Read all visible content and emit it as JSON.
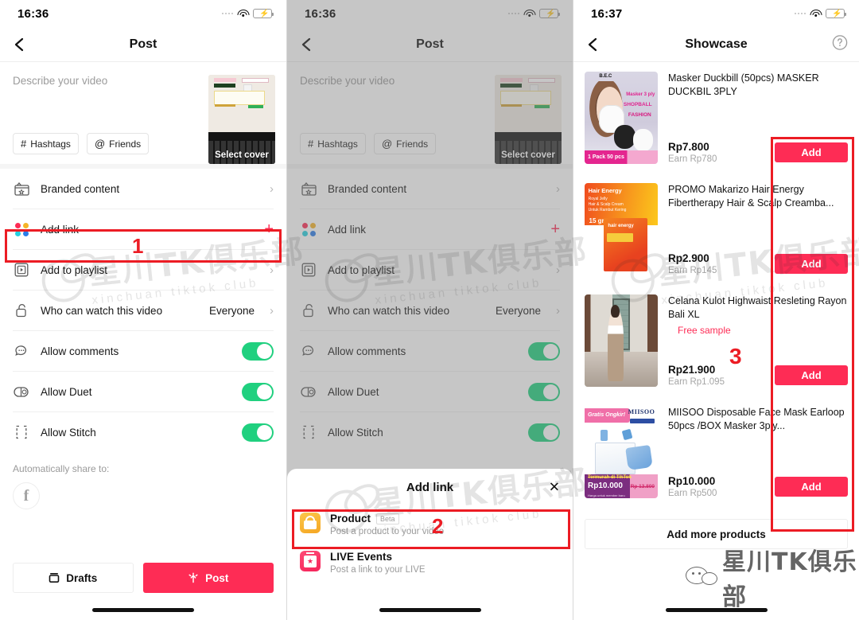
{
  "panels": [
    {
      "status": {
        "time": "16:36"
      },
      "nav": {
        "title": "Post",
        "back_icon": "chevron-left-icon"
      },
      "compose": {
        "placeholder": "Describe your video",
        "chips": [
          {
            "icon": "hashtag-icon",
            "glyph": "#",
            "label": "Hashtags"
          },
          {
            "icon": "at-icon",
            "glyph": "@",
            "label": "Friends"
          }
        ],
        "cover_label": "Select cover"
      },
      "rows": [
        {
          "icon": "branded-content-icon",
          "label": "Branded content",
          "accessory": "chevron",
          "value": ""
        },
        {
          "icon": "add-link-dots-icon",
          "label": "Add link",
          "accessory": "plus",
          "value": ""
        },
        {
          "icon": "playlist-icon",
          "label": "Add to playlist",
          "accessory": "chevron",
          "value": ""
        },
        {
          "icon": "lock-icon",
          "label": "Who can watch this video",
          "accessory": "chevron",
          "value": "Everyone"
        },
        {
          "icon": "comment-icon",
          "label": "Allow comments",
          "accessory": "toggle",
          "value": "on"
        },
        {
          "icon": "duet-icon",
          "label": "Allow Duet",
          "accessory": "toggle",
          "value": "on"
        },
        {
          "icon": "stitch-icon",
          "label": "Allow Stitch",
          "accessory": "toggle",
          "value": "on"
        }
      ],
      "share": {
        "label": "Automatically share to:",
        "network_icon": "facebook-icon",
        "network_glyph": "f"
      },
      "footer": {
        "drafts_label": "Drafts",
        "post_label": "Post"
      },
      "annotation": {
        "number": "1"
      }
    },
    {
      "status": {
        "time": "16:36"
      },
      "nav": {
        "title": "Post",
        "back_icon": "chevron-left-icon"
      },
      "compose": {
        "placeholder": "Describe your video",
        "chips": [
          {
            "icon": "hashtag-icon",
            "glyph": "#",
            "label": "Hashtags"
          },
          {
            "icon": "at-icon",
            "glyph": "@",
            "label": "Friends"
          }
        ],
        "cover_label": "Select cover"
      },
      "rows": [
        {
          "icon": "branded-content-icon",
          "label": "Branded content",
          "accessory": "chevron",
          "value": ""
        },
        {
          "icon": "add-link-dots-icon",
          "label": "Add link",
          "accessory": "plus",
          "value": ""
        },
        {
          "icon": "playlist-icon",
          "label": "Add to playlist",
          "accessory": "chevron",
          "value": ""
        },
        {
          "icon": "lock-icon",
          "label": "Who can watch this video",
          "accessory": "chevron",
          "value": "Everyone"
        },
        {
          "icon": "comment-icon",
          "label": "Allow comments",
          "accessory": "toggle",
          "value": "on"
        },
        {
          "icon": "duet-icon",
          "label": "Allow Duet",
          "accessory": "toggle",
          "value": "on"
        },
        {
          "icon": "stitch-icon",
          "label": "Allow Stitch",
          "accessory": "toggle",
          "value": "on"
        }
      ],
      "sheet": {
        "title": "Add link",
        "close_icon": "close-icon",
        "items": [
          {
            "icon": "product-bag-icon",
            "title": "Product",
            "badge": "Beta",
            "subtitle": "Post a product to your video"
          },
          {
            "icon": "live-events-calendar-icon",
            "title": "LIVE Events",
            "badge": "",
            "subtitle": "Post a link to your LIVE"
          }
        ]
      },
      "annotation": {
        "number": "2"
      }
    },
    {
      "status": {
        "time": "16:37"
      },
      "nav": {
        "title": "Showcase",
        "back_icon": "chevron-left-icon",
        "help_icon": "help-circle-icon"
      },
      "products": [
        {
          "thumb": "mask-duckbill-thumb",
          "name": "Masker Duckbill (50pcs) MASKER DUCKBIL 3PLY",
          "free_sample": "",
          "price": "Rp7.800",
          "earn": "Earn Rp780",
          "add_label": "Add",
          "thumb_texts": {
            "brand": "B.E.C",
            "l1": "Masker 3 ply",
            "l2": "SHOPBALL",
            "l3": "FASHION",
            "bar": "1 Pack 50 pcs"
          }
        },
        {
          "thumb": "hair-energy-thumb",
          "name": "PROMO Makarizo Hair Energy Fibertherapy Hair & Scalp Creamba...",
          "free_sample": "",
          "price": "Rp2.900",
          "earn": "Earn Rp145",
          "add_label": "Add",
          "thumb_texts": {
            "title": "Hair Energy",
            "sub": "Royal Jelly\nHair & Scalp Cream\nUntuk Rambut Kering",
            "gram": "15 gr",
            "logo": "hair energy"
          }
        },
        {
          "thumb": "celana-kulot-thumb",
          "name": "Celana Kulot Highwaist Resleting Rayon Bali XL",
          "free_sample": "Free sample",
          "price": "Rp21.900",
          "earn": "Earn Rp1.095",
          "add_label": "Add",
          "thumb_texts": {}
        },
        {
          "thumb": "miisoo-mask-thumb",
          "name": "MIISOO Disposable Face Mask Earloop 50pcs /BOX Masker 3ply...",
          "free_sample": "",
          "price": "Rp10.000",
          "earn": "Earn Rp500",
          "add_label": "Add",
          "thumb_texts": {
            "ribbon": "Gratis Ongkir!",
            "brand": "MIISOO",
            "promo": "Termurah di TikTok",
            "price": "Rp10.000",
            "strike": "Rp 13.800",
            "note": "Harga untuk member baru"
          }
        }
      ],
      "add_more_label": "Add more products",
      "annotation": {
        "number": "3"
      }
    }
  ],
  "watermark": {
    "cn": "星川TK俱乐部",
    "en": "xinchuan tiktok club",
    "logo_cn": "星川TK俱乐部"
  },
  "colors": {
    "accent": "#fe2c55",
    "toggle_on": "#20d07f",
    "annotation": "#ec1c24",
    "battery": "#32d74b"
  }
}
